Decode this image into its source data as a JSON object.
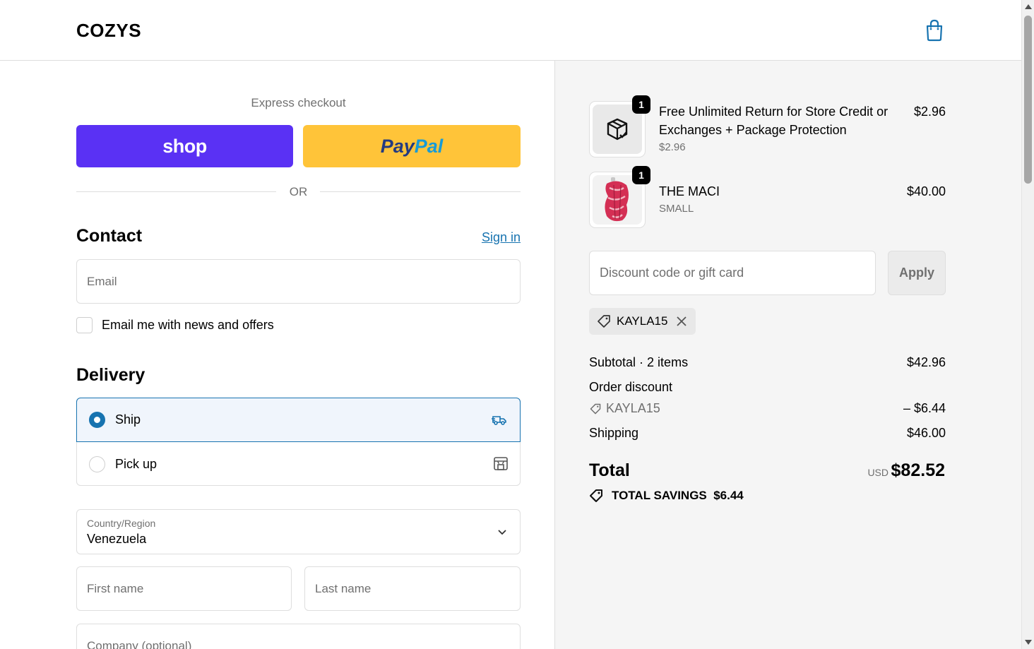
{
  "header": {
    "brand": "COZYS",
    "cart_icon": "shopping-bag-icon"
  },
  "express": {
    "title": "Express checkout",
    "shop_label": "shop",
    "paypal_part1": "Pay",
    "paypal_part2": "Pal",
    "or_label": "OR"
  },
  "contact": {
    "title": "Contact",
    "sign_in": "Sign in",
    "email_placeholder": "Email",
    "newsletter_label": "Email me with news and offers"
  },
  "delivery": {
    "title": "Delivery",
    "options": [
      {
        "label": "Ship",
        "selected": true,
        "icon": "truck-icon"
      },
      {
        "label": "Pick up",
        "selected": false,
        "icon": "store-icon"
      }
    ],
    "country_label": "Country/Region",
    "country_value": "Venezuela",
    "first_name_placeholder": "First name",
    "last_name_placeholder": "Last name",
    "company_placeholder": "Company (optional)"
  },
  "summary": {
    "items": [
      {
        "title": "Free Unlimited Return for Store Credit or Exchanges + Package Protection",
        "subtitle": "$2.96",
        "price": "$2.96",
        "qty": "1",
        "thumb_icon": "package-check-icon"
      },
      {
        "title": "THE MACI",
        "subtitle": "SMALL",
        "price": "$40.00",
        "qty": "1",
        "thumb_icon": "product-image"
      }
    ],
    "discount_placeholder": "Discount code or gift card",
    "apply_label": "Apply",
    "applied_code": "KAYLA15",
    "subtotal_label": "Subtotal · 2 items",
    "subtotal_value": "$42.96",
    "order_discount_label": "Order discount",
    "order_discount_code": "KAYLA15",
    "order_discount_value": "– $6.44",
    "shipping_label": "Shipping",
    "shipping_value": "$46.00",
    "total_label": "Total",
    "total_currency": "USD",
    "total_value": "$82.52",
    "savings_label": "TOTAL SAVINGS",
    "savings_value": "$6.44"
  },
  "colors": {
    "shop": "#5a31f4",
    "paypal": "#ffc439",
    "accent": "#1773b0"
  }
}
